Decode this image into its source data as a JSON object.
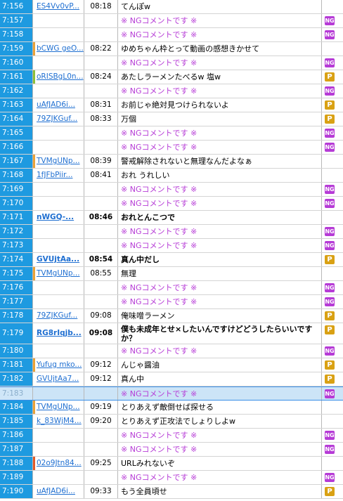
{
  "rows": [
    {
      "num": "7:156",
      "id": "ES4Vv0vP...",
      "time": "08:18",
      "msg": "てんぽw",
      "ng": false,
      "badge": "",
      "stripe": "",
      "bold": false
    },
    {
      "num": "7:157",
      "id": "",
      "time": "",
      "msg": "※ NGコメントです ※",
      "ng": true,
      "badge": "NG",
      "stripe": "",
      "bold": false
    },
    {
      "num": "7:158",
      "id": "",
      "time": "",
      "msg": "※ NGコメントです ※",
      "ng": true,
      "badge": "NG",
      "stripe": "",
      "bold": false
    },
    {
      "num": "7:159",
      "id": "bCWG geO...",
      "time": "08:22",
      "msg": "ゆめちゃん枠とって動画の感想きかせて",
      "ng": false,
      "badge": "",
      "stripe": "#e8a23a",
      "bold": false
    },
    {
      "num": "7:160",
      "id": "",
      "time": "",
      "msg": "※ NGコメントです ※",
      "ng": true,
      "badge": "NG",
      "stripe": "",
      "bold": false
    },
    {
      "num": "7:161",
      "id": "oRISBgL0n...",
      "time": "08:24",
      "msg": "あたしラーメンたべるw 塩w",
      "ng": false,
      "badge": "P",
      "stripe": "#8dbf3a",
      "bold": false
    },
    {
      "num": "7:162",
      "id": "",
      "time": "",
      "msg": "※ NGコメントです ※",
      "ng": true,
      "badge": "NG",
      "stripe": "",
      "bold": false
    },
    {
      "num": "7:163",
      "id": "uAfJAD6i...",
      "time": "08:31",
      "msg": "お前じゃ絶対見つけられないよ",
      "ng": false,
      "badge": "P",
      "stripe": "",
      "bold": false
    },
    {
      "num": "7:164",
      "id": "79ZJKGuf...",
      "time": "08:33",
      "msg": "万個",
      "ng": false,
      "badge": "P",
      "stripe": "",
      "bold": false
    },
    {
      "num": "7:165",
      "id": "",
      "time": "",
      "msg": "※ NGコメントです ※",
      "ng": true,
      "badge": "NG",
      "stripe": "",
      "bold": false
    },
    {
      "num": "7:166",
      "id": "",
      "time": "",
      "msg": "※ NGコメントです ※",
      "ng": true,
      "badge": "NG",
      "stripe": "",
      "bold": false
    },
    {
      "num": "7:167",
      "id": "TVMgUNp...",
      "time": "08:39",
      "msg": "警戒解除されないと無理なんだよなぁ",
      "ng": false,
      "badge": "",
      "stripe": "#e8a23a",
      "bold": false
    },
    {
      "num": "7:168",
      "id": "1fJFbPiir...",
      "time": "08:41",
      "msg": "おれ うれしい",
      "ng": false,
      "badge": "",
      "stripe": "",
      "bold": false
    },
    {
      "num": "7:169",
      "id": "",
      "time": "",
      "msg": "※ NGコメントです ※",
      "ng": true,
      "badge": "NG",
      "stripe": "",
      "bold": false
    },
    {
      "num": "7:170",
      "id": "",
      "time": "",
      "msg": "※ NGコメントです ※",
      "ng": true,
      "badge": "NG",
      "stripe": "",
      "bold": false
    },
    {
      "num": "7:171",
      "id": "nWGQ-...",
      "time": "08:46",
      "msg": "おれとんこつで",
      "ng": false,
      "badge": "",
      "stripe": "",
      "bold": true
    },
    {
      "num": "7:172",
      "id": "",
      "time": "",
      "msg": "※ NGコメントです ※",
      "ng": true,
      "badge": "NG",
      "stripe": "",
      "bold": false
    },
    {
      "num": "7:173",
      "id": "",
      "time": "",
      "msg": "※ NGコメントです ※",
      "ng": true,
      "badge": "NG",
      "stripe": "",
      "bold": false
    },
    {
      "num": "7:174",
      "id": "GVUjtAa...",
      "time": "08:54",
      "msg": "真ん中だし",
      "ng": false,
      "badge": "P",
      "stripe": "",
      "bold": true
    },
    {
      "num": "7:175",
      "id": "TVMgUNp...",
      "time": "08:55",
      "msg": "無理",
      "ng": false,
      "badge": "",
      "stripe": "#e8a23a",
      "bold": false
    },
    {
      "num": "7:176",
      "id": "",
      "time": "",
      "msg": "※ NGコメントです ※",
      "ng": true,
      "badge": "NG",
      "stripe": "",
      "bold": false
    },
    {
      "num": "7:177",
      "id": "",
      "time": "",
      "msg": "※ NGコメントです ※",
      "ng": true,
      "badge": "NG",
      "stripe": "",
      "bold": false
    },
    {
      "num": "7:178",
      "id": "79ZJKGuf...",
      "time": "09:08",
      "msg": "俺味噌ラーメン",
      "ng": false,
      "badge": "P",
      "stripe": "",
      "bold": false
    },
    {
      "num": "7:179",
      "id": "RG8rIqjb...",
      "time": "09:08",
      "msg": "僕も未成年とせ×したいんですけどどうしたらいいですか？",
      "ng": false,
      "badge": "P",
      "stripe": "",
      "bold": true,
      "tall": true
    },
    {
      "num": "7:180",
      "id": "",
      "time": "",
      "msg": "※ NGコメントです ※",
      "ng": true,
      "badge": "NG",
      "stripe": "",
      "bold": false
    },
    {
      "num": "7:181",
      "id": "Yufug mko...",
      "time": "09:12",
      "msg": "んじゃ醤油",
      "ng": false,
      "badge": "P",
      "stripe": "#e8a23a",
      "bold": false
    },
    {
      "num": "7:182",
      "id": "GVUjtAa7...",
      "time": "09:12",
      "msg": "真ん中",
      "ng": false,
      "badge": "P",
      "stripe": "",
      "bold": false
    },
    {
      "num": "7:183",
      "id": "",
      "time": "",
      "msg": "※ NGコメントです ※",
      "ng": true,
      "badge": "NG",
      "stripe": "",
      "bold": false,
      "selected": true
    },
    {
      "num": "7:184",
      "id": "TVMgUNp...",
      "time": "09:19",
      "msg": "とりあえず敵倒せば探せる",
      "ng": false,
      "badge": "",
      "stripe": "#e8a23a",
      "bold": false
    },
    {
      "num": "7:185",
      "id": "k_83WjM4...",
      "time": "09:20",
      "msg": "とりあえず正攻法でしょりしよw",
      "ng": false,
      "badge": "",
      "stripe": "",
      "bold": false
    },
    {
      "num": "7:186",
      "id": "",
      "time": "",
      "msg": "※ NGコメントです ※",
      "ng": true,
      "badge": "NG",
      "stripe": "",
      "bold": false
    },
    {
      "num": "7:187",
      "id": "",
      "time": "",
      "msg": "※ NGコメントです ※",
      "ng": true,
      "badge": "NG",
      "stripe": "",
      "bold": false
    },
    {
      "num": "7:188",
      "id": "02o9Jtn84...",
      "time": "09:25",
      "msg": "URLみれないぞ",
      "ng": false,
      "badge": "",
      "stripe": "#e05a2a",
      "bold": false
    },
    {
      "num": "7:189",
      "id": "",
      "time": "",
      "msg": "※ NGコメントです ※",
      "ng": true,
      "badge": "NG",
      "stripe": "",
      "bold": false
    },
    {
      "num": "7:190",
      "id": "uAfJAD6i...",
      "time": "09:33",
      "msg": "もう全員頃せ",
      "ng": false,
      "badge": "P",
      "stripe": "",
      "bold": false
    }
  ]
}
